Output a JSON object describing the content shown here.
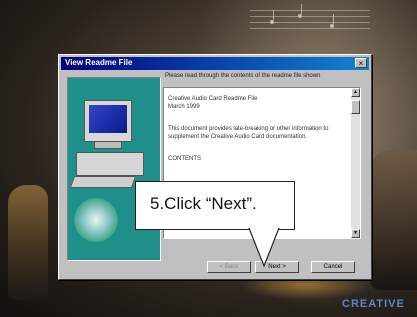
{
  "dialog": {
    "title": "View Readme File",
    "close_glyph": "×",
    "instruction": "Please read through the contents of the readme file shown",
    "readme_lines": [
      "Creative Audio Card Readme File",
      "March 1999",
      "This document provides late-breaking or other information to",
      "supplement the Creative Audio Card documentation.",
      "CONTENTS"
    ],
    "buttons": {
      "back": "< Back",
      "next": "Next >",
      "cancel": "Cancel"
    }
  },
  "callout": {
    "text": "5.Click “Next”."
  },
  "brand": {
    "text": "CREATIVE"
  },
  "colors": {
    "title_bar": "#000080",
    "side_panel": "#1f8f8a",
    "brand": "#5b87c9"
  }
}
